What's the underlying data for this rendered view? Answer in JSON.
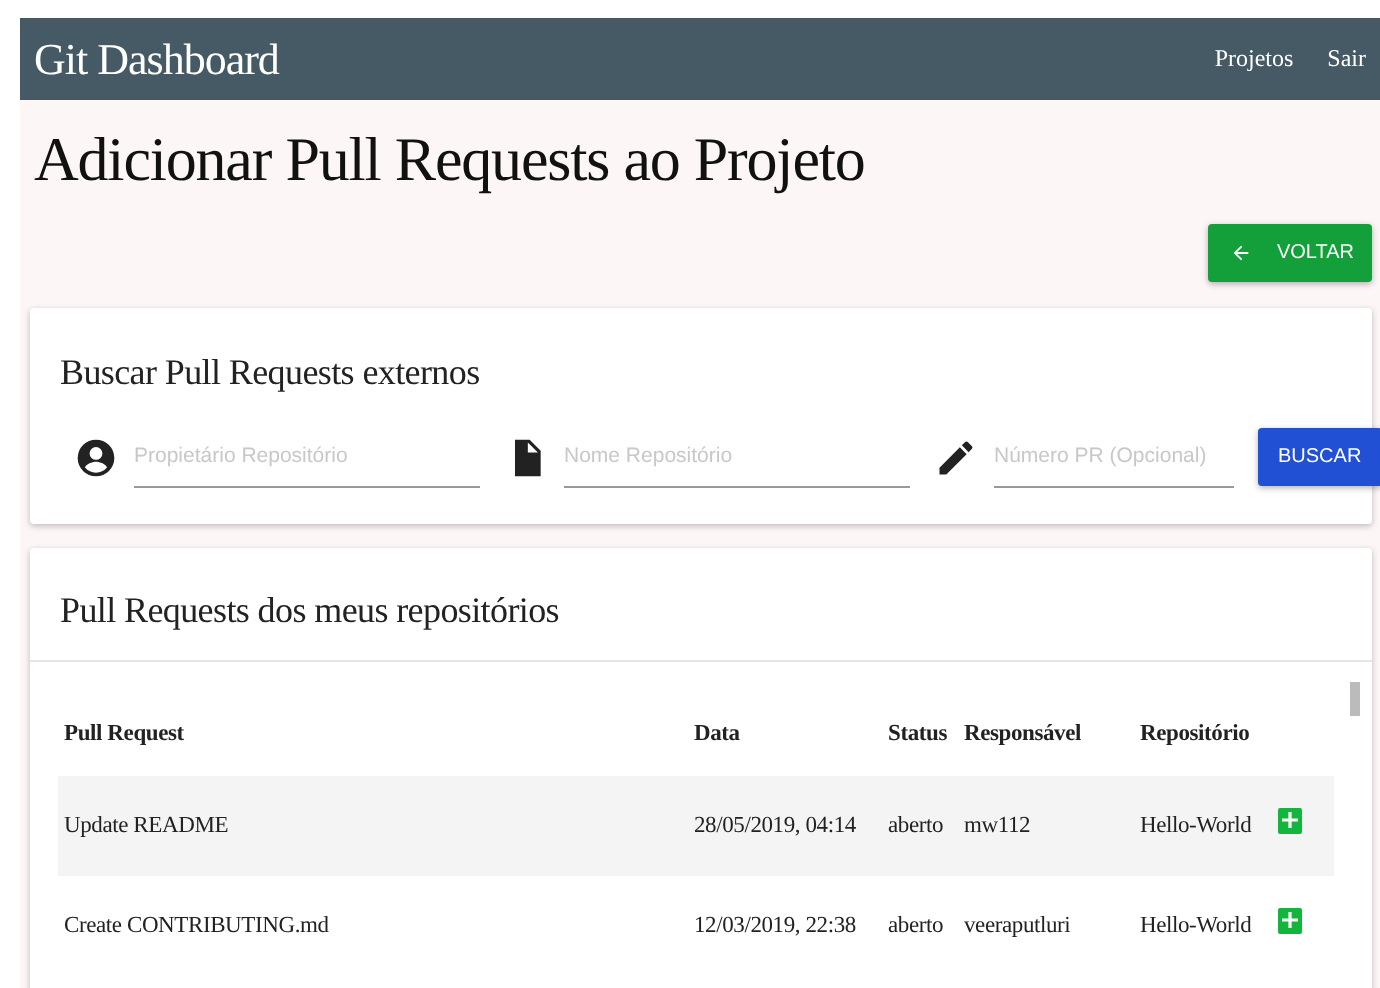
{
  "navbar": {
    "title": "Git Dashboard",
    "links": [
      "Projetos",
      "Sair"
    ]
  },
  "page_title": "Adicionar Pull Requests ao Projeto",
  "back_button": {
    "label": "VOLTAR"
  },
  "search_card": {
    "title": "Buscar Pull Requests externos",
    "fields": [
      {
        "kind": "person",
        "placeholder": "Propietário Repositório"
      },
      {
        "kind": "file",
        "placeholder": "Nome Repositório"
      },
      {
        "kind": "pencil",
        "placeholder": "Número PR (Opcional)"
      }
    ],
    "button": "BUSCAR"
  },
  "table_card": {
    "title": "Pull Requests dos meus repositórios",
    "columns": [
      "Pull Request",
      "Data",
      "Status",
      "Responsável",
      "Repositório"
    ],
    "rows": [
      {
        "pull_request": "Update README",
        "data": "28/05/2019, 04:14",
        "status": "aberto",
        "responsavel": "mw112",
        "repositorio": "Hello-World"
      },
      {
        "pull_request": "Create CONTRIBUTING.md",
        "data": "12/03/2019, 22:38",
        "status": "aberto",
        "responsavel": "veeraputluri",
        "repositorio": "Hello-World"
      }
    ]
  }
}
